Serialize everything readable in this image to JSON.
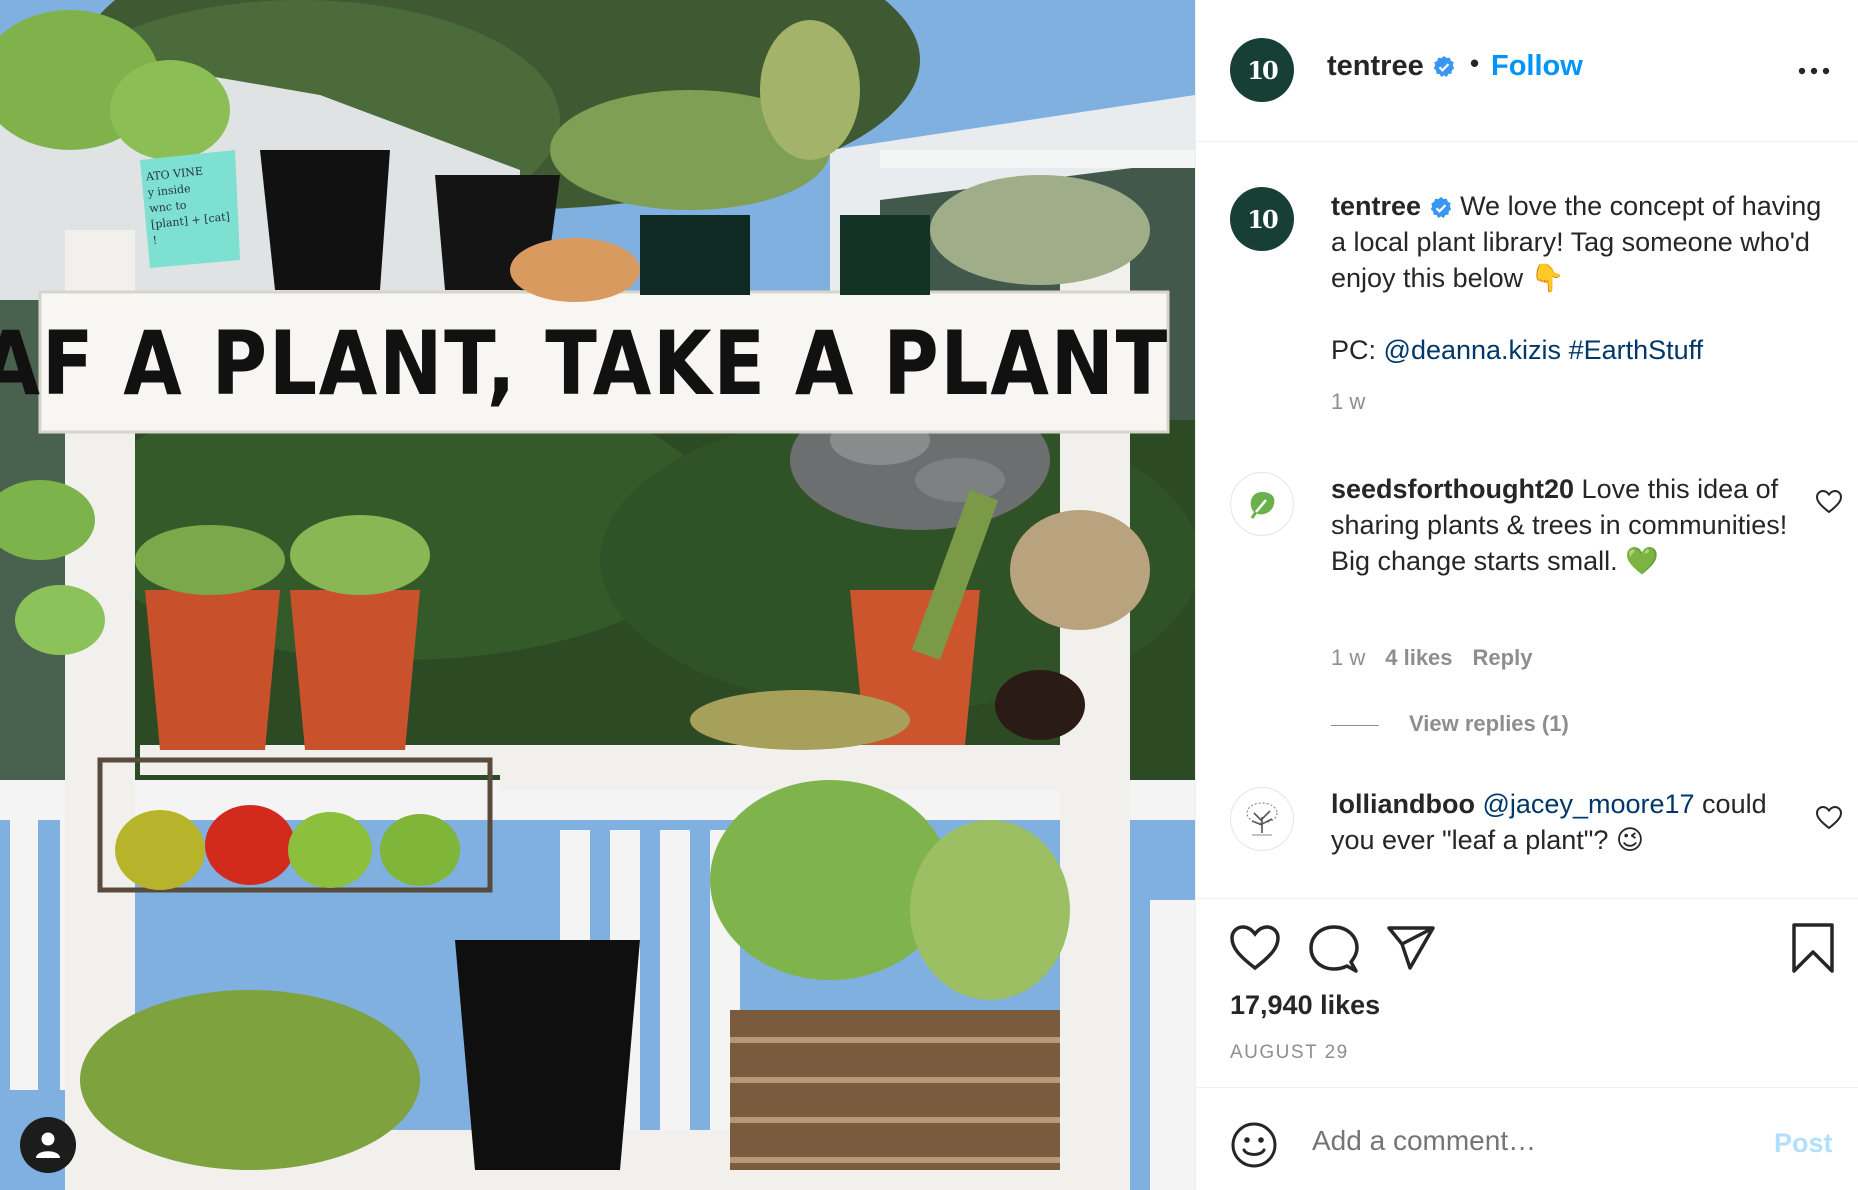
{
  "photo": {
    "sign_text": "LEAF A PLANT, TAKE A PLANT",
    "note_text": "ATO VINE\ny inside\nwnc to\n[plant] + [cat] !",
    "user_tag_icon": "person-icon"
  },
  "post": {
    "username": "tentree",
    "avatar_text": "10",
    "verified_icon": "verified-badge-icon",
    "separator": "•",
    "follow_label": "Follow",
    "more_icon": "more-options-icon"
  },
  "caption": {
    "username": "tentree",
    "text": "We love the concept of having a local plant library! Tag someone who'd enjoy this below 👇",
    "pc_label": "PC:",
    "pc_mention": "@deanna.kizis",
    "pc_hashtag": "#EarthStuff",
    "time": "1 w"
  },
  "comments": [
    {
      "username": "seedsforthought20",
      "text": "Love this idea of sharing plants & trees in communities! Big change starts small. 💚",
      "time": "1 w",
      "likes": "4 likes",
      "reply": "Reply",
      "view_replies": "View replies (1)"
    },
    {
      "username": "lolliandboo",
      "mention": "@jacey_moore17",
      "text": "could you ever \"leaf a plant\"? 😉"
    }
  ],
  "actions": {
    "like_icon": "heart-icon",
    "comment_icon": "comment-icon",
    "share_icon": "share-icon",
    "save_icon": "bookmark-icon",
    "likes_count": "17,940 likes",
    "date": "AUGUST 29"
  },
  "composer": {
    "emoji_icon": "emoji-icon",
    "placeholder": "Add a comment…",
    "post_label": "Post"
  },
  "colors": {
    "link": "#0095f6",
    "mention": "#00376b",
    "muted": "#8e8e8e",
    "post_disabled": "#b2dffc",
    "brand_avatar": "#173f35"
  }
}
